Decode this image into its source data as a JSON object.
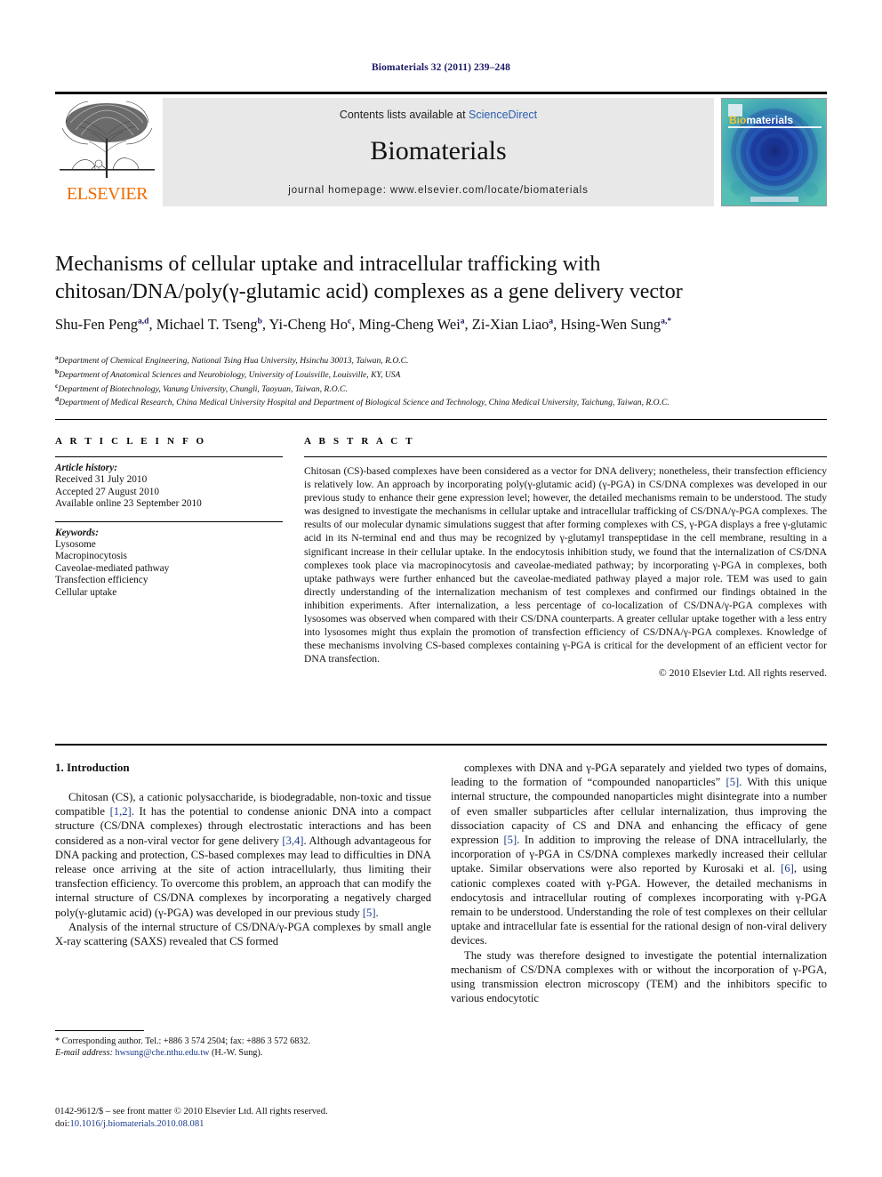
{
  "running_head": "Biomaterials 32 (2011) 239–248",
  "masthead": {
    "publisher_name": "ELSEVIER",
    "contents_prefix": "Contents lists available at ",
    "contents_link": "ScienceDirect",
    "journal_title": "Biomaterials",
    "homepage_line": "journal homepage: www.elsevier.com/locate/biomaterials",
    "cover_title_bio": "Bio",
    "cover_title_materials": "materials"
  },
  "article": {
    "title_line1": "Mechanisms of cellular uptake and intracellular trafficking with",
    "title_line2": "chitosan/DNA/poly(γ-glutamic acid) complexes as a gene delivery vector",
    "authors": [
      {
        "name": "Shu-Fen Peng",
        "sup": "a,d"
      },
      {
        "name": "Michael T. Tseng",
        "sup": "b"
      },
      {
        "name": "Yi-Cheng Ho",
        "sup": "c"
      },
      {
        "name": "Ming-Cheng Wei",
        "sup": "a"
      },
      {
        "name": "Zi-Xian Liao",
        "sup": "a"
      },
      {
        "name": "Hsing-Wen Sung",
        "sup": "a,*"
      }
    ],
    "affiliations": [
      {
        "mark": "a",
        "text": "Department of Chemical Engineering, National Tsing Hua University, Hsinchu 30013, Taiwan, R.O.C."
      },
      {
        "mark": "b",
        "text": "Department of Anatomical Sciences and Neurobiology, University of Louisville, Louisville, KY, USA"
      },
      {
        "mark": "c",
        "text": "Department of Biotechnology, Vanung University, Chungli, Taoyuan, Taiwan, R.O.C."
      },
      {
        "mark": "d",
        "text": "Department of Medical Research, China Medical University Hospital and Department of Biological Science and Technology, China Medical University, Taichung, Taiwan, R.O.C."
      }
    ]
  },
  "article_info": {
    "heading": "A R T I C L E   I N F O",
    "history_label": "Article history:",
    "history": [
      "Received 31 July 2010",
      "Accepted 27 August 2010",
      "Available online 23 September 2010"
    ],
    "keywords_label": "Keywords:",
    "keywords": [
      "Lysosome",
      "Macropinocytosis",
      "Caveolae-mediated pathway",
      "Transfection efficiency",
      "Cellular uptake"
    ]
  },
  "abstract": {
    "heading": "A B S T R A C T",
    "text": "Chitosan (CS)-based complexes have been considered as a vector for DNA delivery; nonetheless, their transfection efficiency is relatively low. An approach by incorporating poly(γ-glutamic acid) (γ-PGA) in CS/DNA complexes was developed in our previous study to enhance their gene expression level; however, the detailed mechanisms remain to be understood. The study was designed to investigate the mechanisms in cellular uptake and intracellular trafficking of CS/DNA/γ-PGA complexes. The results of our molecular dynamic simulations suggest that after forming complexes with CS, γ-PGA displays a free γ-glutamic acid in its N-terminal end and thus may be recognized by γ-glutamyl transpeptidase in the cell membrane, resulting in a significant increase in their cellular uptake. In the endocytosis inhibition study, we found that the internalization of CS/DNA complexes took place via macropinocytosis and caveolae-mediated pathway; by incorporating γ-PGA in complexes, both uptake pathways were further enhanced but the caveolae-mediated pathway played a major role. TEM was used to gain directly understanding of the internalization mechanism of test complexes and confirmed our findings obtained in the inhibition experiments. After internalization, a less percentage of co-localization of CS/DNA/γ-PGA complexes with lysosomes was observed when compared with their CS/DNA counterparts. A greater cellular uptake together with a less entry into lysosomes might thus explain the promotion of transfection efficiency of CS/DNA/γ-PGA complexes. Knowledge of these mechanisms involving CS-based complexes containing γ-PGA is critical for the development of an efficient vector for DNA transfection.",
    "copyright": "© 2010 Elsevier Ltd. All rights reserved."
  },
  "body": {
    "section_heading": "1. Introduction",
    "left_paragraphs": [
      "Chitosan (CS), a cationic polysaccharide, is biodegradable, non-toxic and tissue compatible [1,2]. It has the potential to condense anionic DNA into a compact structure (CS/DNA complexes) through electrostatic interactions and has been considered as a non-viral vector for gene delivery [3,4]. Although advantageous for DNA packing and protection, CS-based complexes may lead to difficulties in DNA release once arriving at the site of action intracellularly, thus limiting their transfection efficiency. To overcome this problem, an approach that can modify the internal structure of CS/DNA complexes by incorporating a negatively charged poly(γ-glutamic acid) (γ-PGA) was developed in our previous study [5].",
      "Analysis of the internal structure of CS/DNA/γ-PGA complexes by small angle X-ray scattering (SAXS) revealed that CS formed"
    ],
    "right_paragraphs": [
      "complexes with DNA and γ-PGA separately and yielded two types of domains, leading to the formation of “compounded nanoparticles” [5]. With this unique internal structure, the compounded nanoparticles might disintegrate into a number of even smaller subparticles after cellular internalization, thus improving the dissociation capacity of CS and DNA and enhancing the efficacy of gene expression [5]. In addition to improving the release of DNA intracellularly, the incorporation of γ-PGA in CS/DNA complexes markedly increased their cellular uptake. Similar observations were also reported by Kurosaki et al. [6], using cationic complexes coated with γ-PGA. However, the detailed mechanisms in endocytosis and intracellular routing of complexes incorporating with γ-PGA remain to be understood. Understanding the role of test complexes on their cellular uptake and intracellular fate is essential for the rational design of non-viral delivery devices.",
      "The study was therefore designed to investigate the potential internalization mechanism of CS/DNA complexes with or without the incorporation of γ-PGA, using transmission electron microscopy (TEM) and the inhibitors specific to various endocytotic"
    ]
  },
  "footnote": {
    "corresponding": "* Corresponding author. Tel.: +886 3 574 2504; fax: +886 3 572 6832.",
    "email_label": "E-mail address:",
    "email": "hwsung@che.nthu.edu.tw",
    "email_suffix": "(H.-W. Sung)."
  },
  "footer": {
    "issn_line": "0142-9612/$ – see front matter © 2010 Elsevier Ltd. All rights reserved.",
    "doi_label": "doi:",
    "doi_value": "10.1016/j.biomaterials.2010.08.081"
  },
  "colors": {
    "link": "#1a3c8c",
    "elsevier_orange": "#F06C00",
    "running_head": "#1a1a66",
    "panel_gray": "#e8e8e8"
  }
}
